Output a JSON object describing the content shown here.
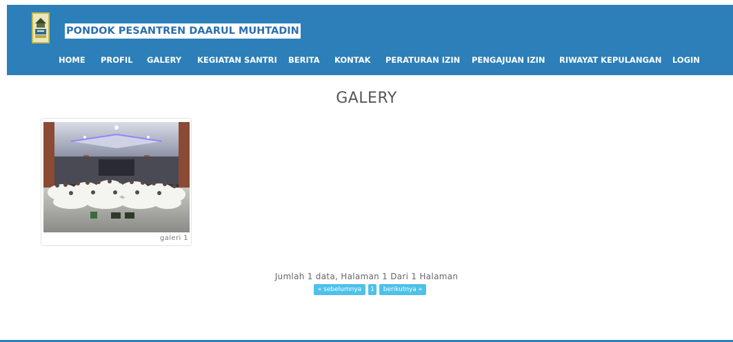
{
  "brand": {
    "name": "PONDOK PESANTREN DAARUL MUHTADIN"
  },
  "nav": {
    "items": [
      {
        "label": "HOME"
      },
      {
        "label": "PROFIL"
      },
      {
        "label": "GALERY"
      },
      {
        "label": "KEGIATAN SANTRI"
      },
      {
        "label": "BERITA"
      },
      {
        "label": "KONTAK"
      },
      {
        "label": "PERATURAN IZIN"
      },
      {
        "label": "PENGAJUAN IZIN"
      },
      {
        "label": "RIWAYAT KEPULANGAN"
      },
      {
        "label": "LOGIN"
      }
    ]
  },
  "page": {
    "title": "GALERY"
  },
  "gallery": {
    "items": [
      {
        "caption": "galeri 1"
      }
    ]
  },
  "pagination": {
    "summary": "Jumlah 1 data, Halaman 1 Dari 1 Halaman",
    "prev": "« sebelumnya",
    "current": "1",
    "next": "berikutnya »"
  },
  "colors": {
    "header_bg": "#2c7fb8",
    "pager_bg": "#4fc1e9"
  }
}
